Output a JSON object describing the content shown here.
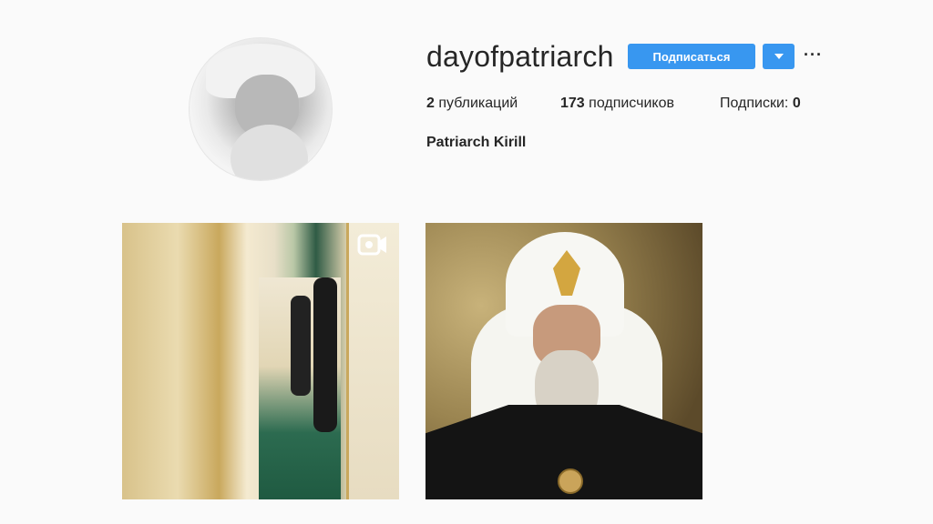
{
  "profile": {
    "username": "dayofpatriarch",
    "follow_label": "Подписаться",
    "more_label": "···",
    "full_name": "Patriarch Kirill",
    "stats": {
      "posts_count": "2",
      "posts_label": "публикаций",
      "followers_count": "173",
      "followers_label": "подписчиков",
      "following_label": "Подписки:",
      "following_count": "0"
    }
  },
  "icons": {
    "dropdown": "chevron-down-icon",
    "more": "more-options-icon",
    "video": "video-icon"
  },
  "colors": {
    "accent": "#3897f0",
    "background": "#fafafa",
    "text": "#262626"
  }
}
